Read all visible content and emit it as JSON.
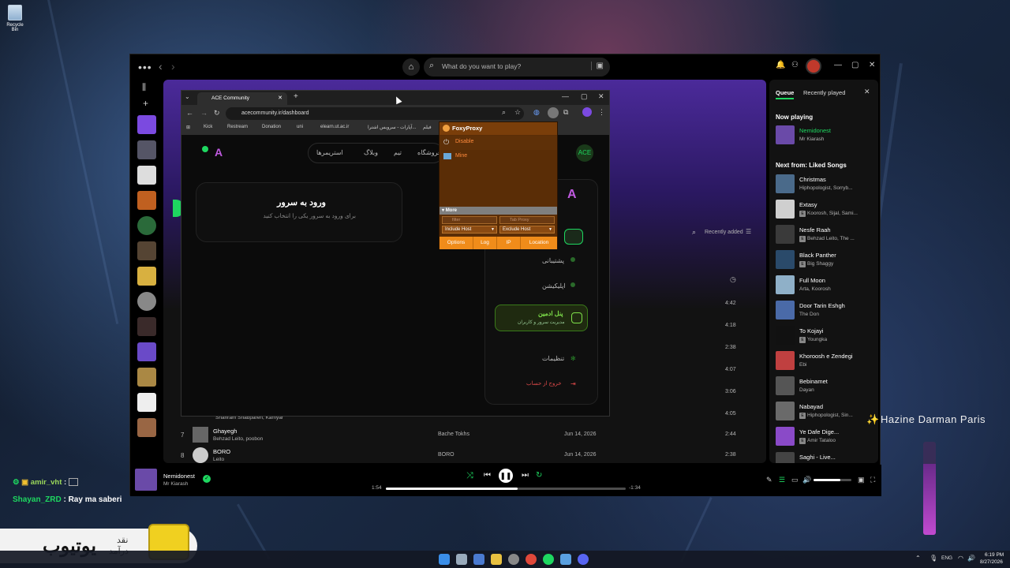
{
  "desktop": {
    "recycle_bin": "Recycle Bin",
    "overlay_text": "Hazine Darman Paris"
  },
  "chat": [
    {
      "user": "amir_vht",
      "sep": " :",
      "text": ""
    },
    {
      "user": "Shayan_ZRD",
      "sep": " :",
      "text": "Ray ma saberi"
    }
  ],
  "banner": {
    "line1": "نقد",
    "line2": "درآمد",
    "big": "یوتیوب"
  },
  "spotify": {
    "search_placeholder": "What do you want to play?",
    "main": {
      "recently_added": "Recently added",
      "durations": [
        "4:42",
        "4:18",
        "2:38",
        "4:07",
        "3:06",
        "4:05",
        "2:44",
        "2:38"
      ],
      "partial_artist": "Shahram Shabpareh, Kamyar",
      "rows": [
        {
          "num": "7",
          "title": "Ghayegh",
          "artist": "Behzad Leito, poobon",
          "album": "Bache Tokhs",
          "date": "Jun 14, 2026",
          "duration": "2:44"
        },
        {
          "num": "8",
          "title": "BORO",
          "artist": "Leito",
          "album": "BORO",
          "date": "Jun 14, 2026",
          "duration": "2:38"
        }
      ]
    },
    "queue": {
      "tab_queue": "Queue",
      "tab_recent": "Recently played",
      "now_playing_label": "Now playing",
      "now_playing": {
        "title": "Nemidonest",
        "artist": "Mr Kiarash"
      },
      "next_from_label": "Next from: Liked Songs",
      "items": [
        {
          "title": "Christmas",
          "artist": "Hiphopologist, Sorryb...",
          "explicit": false,
          "color": "#4a6a8a"
        },
        {
          "title": "Extasy",
          "artist": "Koorosh, Sijal, Sami...",
          "explicit": true,
          "color": "#cfcfcf"
        },
        {
          "title": "Nesfe Raah",
          "artist": "Behzad Leito, The ...",
          "explicit": true,
          "color": "#3a3a3a"
        },
        {
          "title": "Black Panther",
          "artist": "Big Shaggy",
          "explicit": true,
          "color": "#2a4a6a"
        },
        {
          "title": "Full Moon",
          "artist": "Arta, Koorosh",
          "explicit": false,
          "color": "#8fb0c8"
        },
        {
          "title": "Door Tarin Eshgh",
          "artist": "The Don",
          "explicit": false,
          "color": "#4a6aa8"
        },
        {
          "title": "To Kojayi",
          "artist": "Youngka",
          "explicit": true,
          "color": "#111111"
        },
        {
          "title": "Khoroosh e Zendegi",
          "artist": "Ebi",
          "explicit": false,
          "color": "#c04040"
        },
        {
          "title": "Bebinamet",
          "artist": "Dayan",
          "explicit": false,
          "color": "#555555"
        },
        {
          "title": "Nabayad",
          "artist": "Hiphopologist, Sin...",
          "explicit": true,
          "color": "#6a6a6a"
        },
        {
          "title": "Ye Dafe Dige...",
          "artist": "Amir Tataloo",
          "explicit": true,
          "color": "#8a4ac8"
        },
        {
          "title": "Saghi - Live...",
          "artist": "",
          "explicit": false,
          "color": "#444444"
        }
      ]
    },
    "player": {
      "title": "Nemidonest",
      "artist": "Mr Kiarash",
      "elapsed": "1:54",
      "remaining": "-1:34",
      "progress": 0.55,
      "volume": 0.7
    }
  },
  "browser": {
    "tab_title": "ACE Community",
    "url": "acecommunity.ir/dashboard",
    "bookmarks": [
      "Kick",
      "Restream",
      "Donation",
      "uni",
      "elearn.ut.ac.ir",
      "آپارات - سرویس اشترا...",
      "فیلم"
    ],
    "site": {
      "nav": [
        "استریمرها",
        "وبلاگ",
        "تیم",
        "فروشگاه"
      ],
      "login_title": "ورود به سرور",
      "login_sub": "برای ورود به سرور یکی را انتخاب کنید",
      "menu": [
        {
          "label": "پشتیبانی",
          "sub": "",
          "active": false
        },
        {
          "label": "اپلیکیشن",
          "sub": "",
          "active": false
        },
        {
          "label": "پنل ادمین",
          "sub": "مدیریت سرور و کاربران",
          "active": true
        },
        {
          "label": "تنظیمات",
          "sub": "",
          "active": false
        }
      ],
      "logout": "خروج از حساب"
    }
  },
  "foxy": {
    "title": "FoxyProxy",
    "disable": "Disable",
    "mine": "Mine",
    "more": "More",
    "filter_placeholder": "filter",
    "proxy_placeholder": "Tab Proxy",
    "include": "Include Host",
    "exclude": "Exclude Host",
    "buttons": [
      "Options",
      "Log",
      "IP",
      "Location"
    ]
  },
  "taskbar": {
    "lang": "ENG",
    "time": "6:19 PM",
    "date": "8/27/2026"
  },
  "colors": {
    "spotify_green": "#1ed760",
    "foxy_orange": "#f08c1a",
    "accent_purple": "#6b3ec8"
  }
}
